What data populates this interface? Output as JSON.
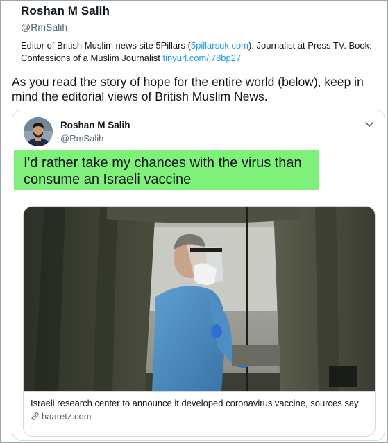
{
  "profile": {
    "name": "Roshan M Salih",
    "handle": "@RmSalih",
    "bio_prefix": "Editor of British Muslim news site 5Pillars (",
    "bio_link1": "5pillarsuk.com",
    "bio_middle": "). Journalist at Press TV. Book: Confessions of a Muslim Journalist ",
    "bio_link2": "tinyurl.com/j78bp27"
  },
  "commentary": "As you read the story of hope for the entire world (below), keep in mind the editorial views of British Muslim News.",
  "tweet": {
    "author_name": "Roshan M Salih",
    "author_handle": "@RmSalih",
    "text": "I'd rather take my chances with the virus than consume an Israeli vaccine",
    "highlight_color": "#7ff07a",
    "card": {
      "title": "Israeli research center to announce it developed coronavirus vaccine, sources say",
      "domain": "haaretz.com"
    }
  },
  "icons": {
    "menu": "chevron-down-icon",
    "link": "link-icon"
  },
  "colors": {
    "link": "#1d9bf0",
    "secondary_text": "#536471",
    "border": "#cfd9de"
  }
}
